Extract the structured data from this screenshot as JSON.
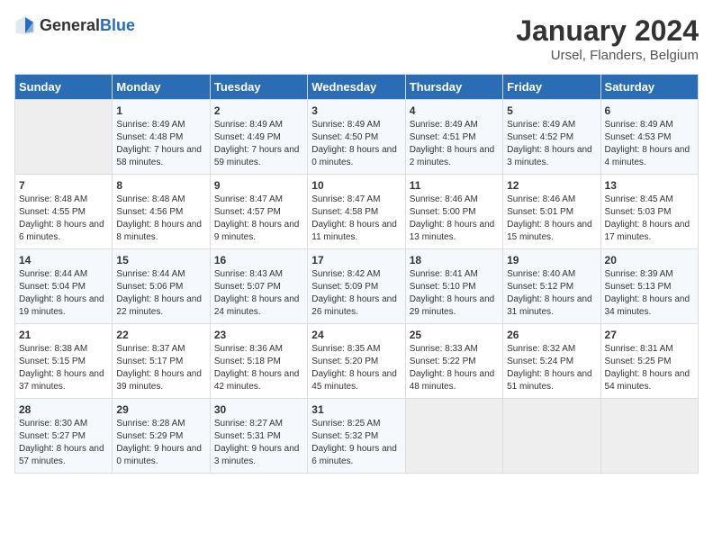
{
  "header": {
    "logo_general": "General",
    "logo_blue": "Blue",
    "month_year": "January 2024",
    "location": "Ursel, Flanders, Belgium"
  },
  "days_of_week": [
    "Sunday",
    "Monday",
    "Tuesday",
    "Wednesday",
    "Thursday",
    "Friday",
    "Saturday"
  ],
  "weeks": [
    [
      {
        "day": "",
        "empty": true
      },
      {
        "day": "1",
        "sunrise": "8:49 AM",
        "sunset": "4:48 PM",
        "daylight": "7 hours and 58 minutes."
      },
      {
        "day": "2",
        "sunrise": "8:49 AM",
        "sunset": "4:49 PM",
        "daylight": "7 hours and 59 minutes."
      },
      {
        "day": "3",
        "sunrise": "8:49 AM",
        "sunset": "4:50 PM",
        "daylight": "8 hours and 0 minutes."
      },
      {
        "day": "4",
        "sunrise": "8:49 AM",
        "sunset": "4:51 PM",
        "daylight": "8 hours and 2 minutes."
      },
      {
        "day": "5",
        "sunrise": "8:49 AM",
        "sunset": "4:52 PM",
        "daylight": "8 hours and 3 minutes."
      },
      {
        "day": "6",
        "sunrise": "8:49 AM",
        "sunset": "4:53 PM",
        "daylight": "8 hours and 4 minutes."
      }
    ],
    [
      {
        "day": "7",
        "sunrise": "8:48 AM",
        "sunset": "4:55 PM",
        "daylight": "8 hours and 6 minutes."
      },
      {
        "day": "8",
        "sunrise": "8:48 AM",
        "sunset": "4:56 PM",
        "daylight": "8 hours and 8 minutes."
      },
      {
        "day": "9",
        "sunrise": "8:47 AM",
        "sunset": "4:57 PM",
        "daylight": "8 hours and 9 minutes."
      },
      {
        "day": "10",
        "sunrise": "8:47 AM",
        "sunset": "4:58 PM",
        "daylight": "8 hours and 11 minutes."
      },
      {
        "day": "11",
        "sunrise": "8:46 AM",
        "sunset": "5:00 PM",
        "daylight": "8 hours and 13 minutes."
      },
      {
        "day": "12",
        "sunrise": "8:46 AM",
        "sunset": "5:01 PM",
        "daylight": "8 hours and 15 minutes."
      },
      {
        "day": "13",
        "sunrise": "8:45 AM",
        "sunset": "5:03 PM",
        "daylight": "8 hours and 17 minutes."
      }
    ],
    [
      {
        "day": "14",
        "sunrise": "8:44 AM",
        "sunset": "5:04 PM",
        "daylight": "8 hours and 19 minutes."
      },
      {
        "day": "15",
        "sunrise": "8:44 AM",
        "sunset": "5:06 PM",
        "daylight": "8 hours and 22 minutes."
      },
      {
        "day": "16",
        "sunrise": "8:43 AM",
        "sunset": "5:07 PM",
        "daylight": "8 hours and 24 minutes."
      },
      {
        "day": "17",
        "sunrise": "8:42 AM",
        "sunset": "5:09 PM",
        "daylight": "8 hours and 26 minutes."
      },
      {
        "day": "18",
        "sunrise": "8:41 AM",
        "sunset": "5:10 PM",
        "daylight": "8 hours and 29 minutes."
      },
      {
        "day": "19",
        "sunrise": "8:40 AM",
        "sunset": "5:12 PM",
        "daylight": "8 hours and 31 minutes."
      },
      {
        "day": "20",
        "sunrise": "8:39 AM",
        "sunset": "5:13 PM",
        "daylight": "8 hours and 34 minutes."
      }
    ],
    [
      {
        "day": "21",
        "sunrise": "8:38 AM",
        "sunset": "5:15 PM",
        "daylight": "8 hours and 37 minutes."
      },
      {
        "day": "22",
        "sunrise": "8:37 AM",
        "sunset": "5:17 PM",
        "daylight": "8 hours and 39 minutes."
      },
      {
        "day": "23",
        "sunrise": "8:36 AM",
        "sunset": "5:18 PM",
        "daylight": "8 hours and 42 minutes."
      },
      {
        "day": "24",
        "sunrise": "8:35 AM",
        "sunset": "5:20 PM",
        "daylight": "8 hours and 45 minutes."
      },
      {
        "day": "25",
        "sunrise": "8:33 AM",
        "sunset": "5:22 PM",
        "daylight": "8 hours and 48 minutes."
      },
      {
        "day": "26",
        "sunrise": "8:32 AM",
        "sunset": "5:24 PM",
        "daylight": "8 hours and 51 minutes."
      },
      {
        "day": "27",
        "sunrise": "8:31 AM",
        "sunset": "5:25 PM",
        "daylight": "8 hours and 54 minutes."
      }
    ],
    [
      {
        "day": "28",
        "sunrise": "8:30 AM",
        "sunset": "5:27 PM",
        "daylight": "8 hours and 57 minutes."
      },
      {
        "day": "29",
        "sunrise": "8:28 AM",
        "sunset": "5:29 PM",
        "daylight": "9 hours and 0 minutes."
      },
      {
        "day": "30",
        "sunrise": "8:27 AM",
        "sunset": "5:31 PM",
        "daylight": "9 hours and 3 minutes."
      },
      {
        "day": "31",
        "sunrise": "8:25 AM",
        "sunset": "5:32 PM",
        "daylight": "9 hours and 6 minutes."
      },
      {
        "day": "",
        "empty": true
      },
      {
        "day": "",
        "empty": true
      },
      {
        "day": "",
        "empty": true
      }
    ]
  ]
}
